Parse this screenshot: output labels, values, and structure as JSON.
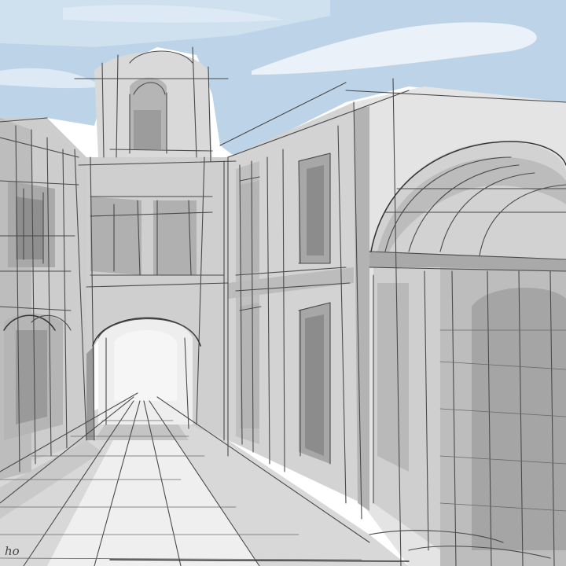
{
  "image": {
    "subject": "sketch",
    "palette": {
      "sky": "#bcd3e8",
      "sky_light": "#dde9f4",
      "cloud": "#eaf1f8",
      "wall_light": "#e4e4e4",
      "wall_mid": "#cdcdcd",
      "wall_dark": "#a9a9a9",
      "wall_shadow": "#8f8f8f",
      "street": "#d8d8d8",
      "street_light": "#efefef",
      "ink": "#4a4a4a"
    }
  },
  "signature": {
    "text": "ho"
  }
}
